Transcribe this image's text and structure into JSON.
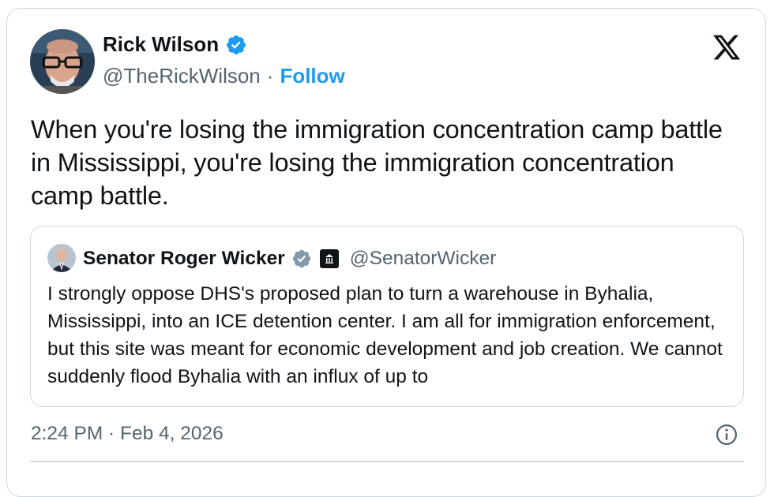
{
  "author": {
    "name": "Rick Wilson",
    "handle": "@TheRickWilson",
    "separator": "·",
    "follow_label": "Follow",
    "verified_icon": "verified-badge-icon",
    "avatar_icon": "avatar"
  },
  "brand_icon": "x-logo-icon",
  "tweet": {
    "text": "When you're losing the immigration concentration camp battle in Mississippi, you're losing the immigration concentration camp battle."
  },
  "quote": {
    "name": "Senator Roger Wicker",
    "handle": "@SenatorWicker",
    "gov_badge_icon": "government-building-icon",
    "text": "I strongly oppose DHS's proposed plan to turn a warehouse in Byhalia, Mississippi, into an ICE detention center. I am all for immigration enforcement, but this site was meant for economic development and job creation. We cannot suddenly flood Byhalia with an influx of up to"
  },
  "timestamp": "2:24 PM · Feb 4, 2026",
  "info_icon": "info-icon",
  "colors": {
    "accent": "#1d9bf0",
    "text": "#0f1419",
    "muted": "#536471",
    "border": "#cfd9de",
    "verified_grey": "#829aab"
  }
}
